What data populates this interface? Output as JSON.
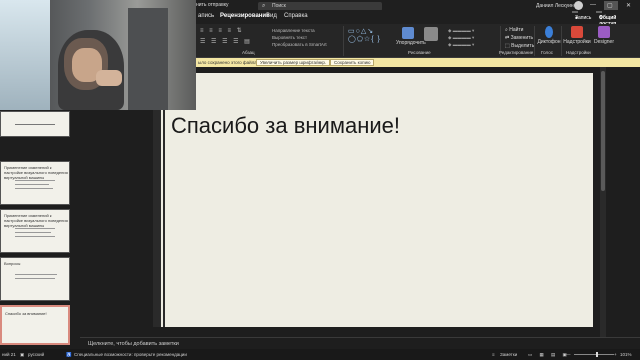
{
  "titlebar": {
    "left_label": "нить отправку",
    "search_placeholder": "Поиск",
    "user_name": "Даниил Лескуин",
    "win_minimize": "—",
    "win_maximize": "▢",
    "win_close": "✕"
  },
  "menu": {
    "items": [
      "апись",
      "Рецензирование",
      "Вид",
      "Справка"
    ]
  },
  "ribbon": {
    "font_group": "Абзац",
    "drawing_group": "Рисование",
    "editing_group": "Редактирование",
    "voice_group": "Голос",
    "find": "Найти",
    "replace": "Заменить",
    "select": "Выделить",
    "dictate": "Диктофон",
    "addins": "Надстройки",
    "designer": "Designer",
    "arrange": "Упорядочить",
    "addins_group": "Надстройки",
    "record_button": "Запись",
    "share_button": "Общий доступ",
    "text_dir": "Направление текста",
    "align_text": "Выровнять текст",
    "smartart": "Преобразовать в SmartArt"
  },
  "message_bar": {
    "text": "ыло сохранено этого файла.",
    "btn_resize": "Увеличить размер шрифта/мкр.",
    "btn_save_copy": "Сохранить копию"
  },
  "thumbnails": [
    {
      "title": ""
    },
    {
      "title": "Применение изменений к настройке визуального поведения виртуальной машины"
    },
    {
      "title": "Применение изменений к настройке визуального поведения виртуальной машины"
    },
    {
      "title": "Вопросы"
    },
    {
      "title": "Спасибо за внимание!"
    }
  ],
  "slide": {
    "title": "Спасибо за внимание!"
  },
  "notes": {
    "placeholder": "Щелкните, чтобы добавить заметки"
  },
  "status": {
    "slide_label": "ний 21",
    "language": "русский",
    "accessibility": "Специальные возможности: проверьте рекомендации",
    "notes_btn": "Заметки",
    "zoom": "101%"
  }
}
